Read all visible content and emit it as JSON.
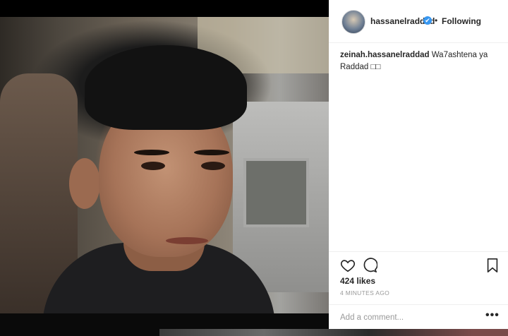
{
  "post": {
    "username": "hassanelraddad",
    "verified_symbol": "✔",
    "separator": "•",
    "follow_status": "Following",
    "comment": {
      "author": "zeinah.hassanelraddad",
      "text": "Wa7ashtena ya Raddad □□"
    },
    "likes": "424 likes",
    "timestamp": "4 MINUTES AGO",
    "add_comment_placeholder": "Add a comment...",
    "more_label": "•••",
    "icons": [
      "heart-icon",
      "comment-icon",
      "bookmark-icon",
      "more-options-icon",
      "verified-badge-icon"
    ]
  },
  "colors": {
    "text": "#262626",
    "muted": "#999999",
    "verified": "#3897f0",
    "border": "#efefef"
  }
}
